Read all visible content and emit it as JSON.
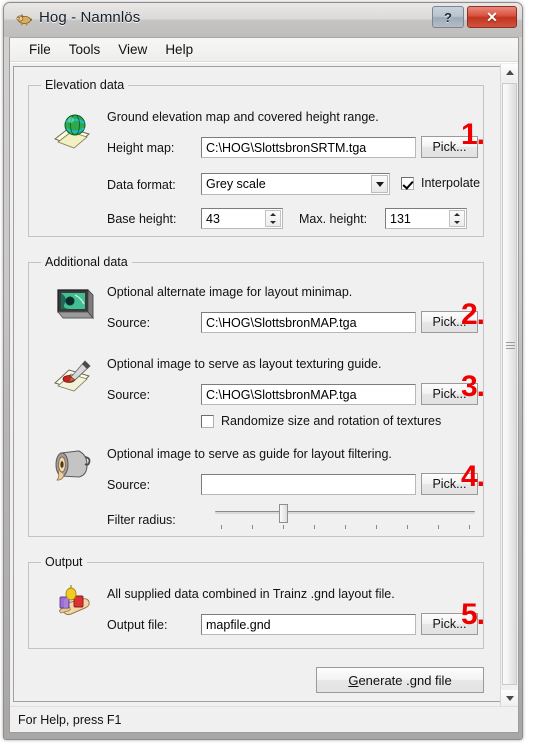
{
  "window": {
    "title": "Hog - Namnlös",
    "app_icon": "hog-icon",
    "help_button": "?",
    "close_button": "✕"
  },
  "menu": {
    "items": [
      {
        "label": "File"
      },
      {
        "label": "Tools"
      },
      {
        "label": "View"
      },
      {
        "label": "Help"
      }
    ]
  },
  "annotations": [
    {
      "text": "1."
    },
    {
      "text": "2."
    },
    {
      "text": "3."
    },
    {
      "text": "4."
    },
    {
      "text": "5."
    }
  ],
  "groups": {
    "elevation": {
      "title": "Elevation data",
      "icon": "globe-on-map-icon",
      "description": "Ground elevation map and covered height range.",
      "height_map_label": "Height map:",
      "height_map_value": "C:\\HOG\\SlottsbronSRTM.tga",
      "height_map_pick": "Pick...",
      "data_format_label": "Data format:",
      "data_format_value": "Grey scale",
      "interpolate_label": "Interpolate",
      "interpolate_checked": true,
      "base_height_label": "Base height:",
      "base_height_value": "43",
      "max_height_label": "Max. height:",
      "max_height_value": "131"
    },
    "additional": {
      "title": "Additional data",
      "minimap": {
        "icon": "minimap-image-icon",
        "description": "Optional alternate image for layout minimap.",
        "source_label": "Source:",
        "source_value": "C:\\HOG\\SlottsbronMAP.tga",
        "pick": "Pick..."
      },
      "texturing": {
        "icon": "paintbrush-icon",
        "description": "Optional image to serve as layout texturing guide.",
        "source_label": "Source:",
        "source_value": "C:\\HOG\\SlottsbronMAP.tga",
        "pick": "Pick...",
        "randomize_label": "Randomize size and rotation of textures",
        "randomize_checked": false
      },
      "filtering": {
        "icon": "sharpener-filter-icon",
        "description": "Optional image to serve as guide for layout filtering.",
        "source_label": "Source:",
        "source_value": "",
        "pick": "Pick...",
        "filter_radius_label": "Filter radius:",
        "filter_radius_ticks": 9,
        "filter_radius_index": 2
      }
    },
    "output": {
      "title": "Output",
      "icon": "hand-with-blocks-icon",
      "description": "All supplied data combined in Trainz .gnd layout file.",
      "output_file_label": "Output file:",
      "output_file_value": "mapfile.gnd",
      "pick": "Pick...",
      "generate_label_prefix": "G",
      "generate_label_rest": "enerate .gnd file"
    }
  },
  "scrollbar": {
    "up_arrow": "scroll-up-icon",
    "down_arrow": "scroll-down-icon"
  },
  "status": {
    "text": "For Help, press F1"
  },
  "colors": {
    "accent_red": "#ee0000",
    "close_red": "#c03520",
    "face": "#f0f0f0"
  }
}
